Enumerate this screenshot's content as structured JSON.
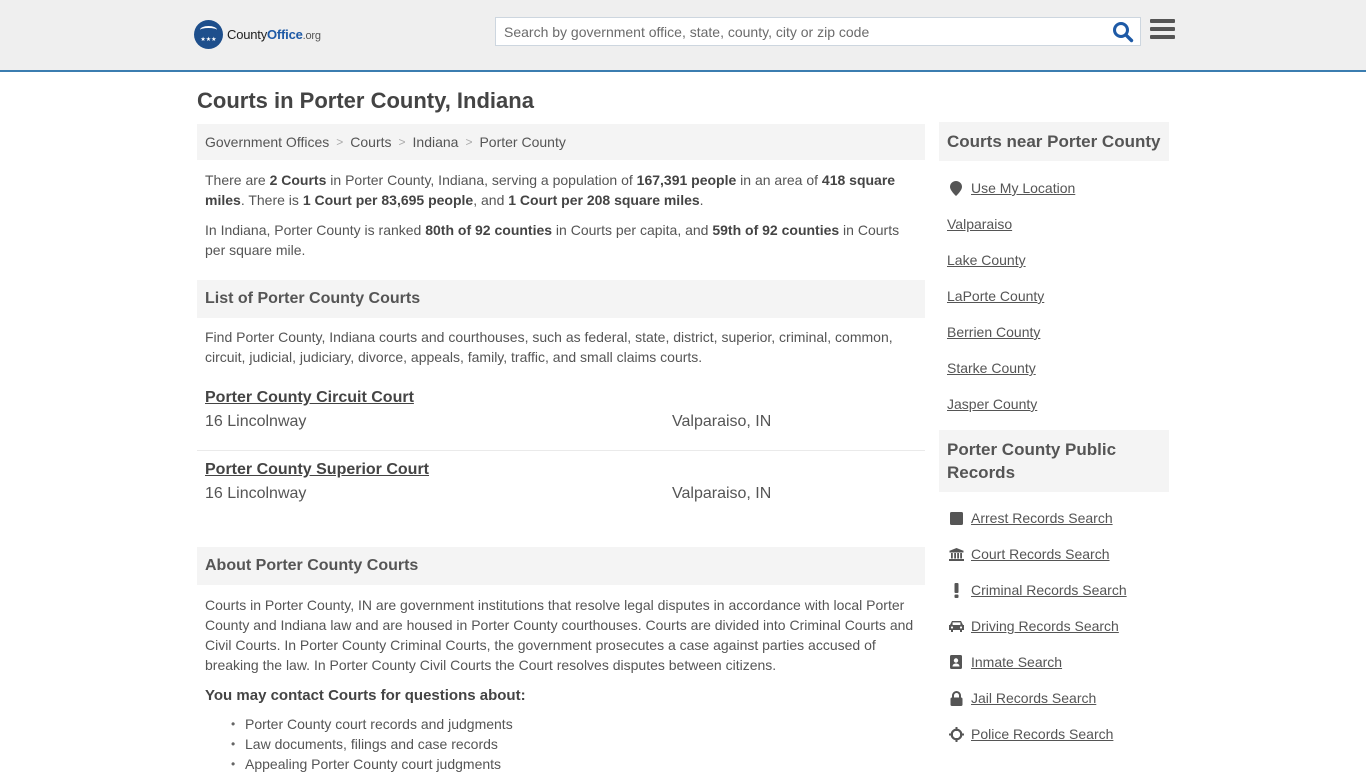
{
  "header": {
    "logo": {
      "county": "County",
      "office": "Office",
      "org": ".org",
      "stars": "★★★"
    },
    "search": {
      "placeholder": "Search by government office, state, county, city or zip code",
      "value": ""
    }
  },
  "page": {
    "title": "Courts in Porter County, Indiana",
    "breadcrumb": [
      {
        "label": "Government Offices"
      },
      {
        "label": "Courts"
      },
      {
        "label": "Indiana"
      },
      {
        "label": "Porter County"
      }
    ],
    "breadcrumb_sep": ">",
    "intro": {
      "p1": {
        "t1": "There are ",
        "b1": "2 Courts",
        "t2": " in Porter County, Indiana, serving a population of ",
        "b2": "167,391 people",
        "t3": " in an area of ",
        "b3": "418 square miles",
        "t4": ". There is ",
        "b4": "1 Court per 83,695 people",
        "t5": ", and ",
        "b5": "1 Court per 208 square miles",
        "t6": "."
      },
      "p2": {
        "t1": "In Indiana, Porter County is ranked ",
        "b1": "80th of 92 counties",
        "t2": " in Courts per capita, and ",
        "b2": "59th of 92 counties",
        "t3": " in Courts per square mile."
      }
    },
    "list_section": {
      "heading": "List of Porter County Courts",
      "description": "Find Porter County, Indiana courts and courthouses, such as federal, state, district, superior, criminal, common, circuit, judicial, judiciary, divorce, appeals, family, traffic, and small claims courts.",
      "courts": [
        {
          "name": "Porter County Circuit Court",
          "address": "16 Lincolnway",
          "city": "Valparaiso, IN"
        },
        {
          "name": "Porter County Superior Court",
          "address": "16 Lincolnway",
          "city": "Valparaiso, IN"
        }
      ]
    },
    "about_section": {
      "heading": "About Porter County Courts",
      "text": "Courts in Porter County, IN are government institutions that resolve legal disputes in accordance with local Porter County and Indiana law and are housed in Porter County courthouses. Courts are divided into Criminal Courts and Civil Courts. In Porter County Criminal Courts, the government prosecutes a case against parties accused of breaking the law. In Porter County Civil Courts the Court resolves disputes between citizens.",
      "contact_heading": "You may contact Courts for questions about:",
      "contact_items": [
        "Porter County court records and judgments",
        "Law documents, filings and case records",
        "Appealing Porter County court judgments"
      ]
    }
  },
  "sidebar": {
    "near": {
      "heading": "Courts near Porter County",
      "items": [
        {
          "label": "Use My Location",
          "icon": "map-marker-icon"
        },
        {
          "label": "Valparaiso"
        },
        {
          "label": "Lake County"
        },
        {
          "label": "LaPorte County"
        },
        {
          "label": "Berrien County"
        },
        {
          "label": "Starke County"
        },
        {
          "label": "Jasper County"
        }
      ]
    },
    "records": {
      "heading": "Porter County Public Records",
      "items": [
        {
          "label": "Arrest Records Search",
          "icon": "square-icon"
        },
        {
          "label": "Court Records Search",
          "icon": "courthouse-icon"
        },
        {
          "label": "Criminal Records Search",
          "icon": "exclamation-icon"
        },
        {
          "label": "Driving Records Search",
          "icon": "car-icon"
        },
        {
          "label": "Inmate Search",
          "icon": "id-badge-icon"
        },
        {
          "label": "Jail Records Search",
          "icon": "lock-icon"
        },
        {
          "label": "Police Records Search",
          "icon": "crosshair-icon"
        }
      ]
    }
  },
  "colors": {
    "accent_border": "#3b7db0",
    "logo_blue": "#1e4f8c",
    "search_icon": "#1e5aa6",
    "text": "#555555",
    "panel_bg": "#f4f4f4",
    "header_bg": "#efefef"
  }
}
